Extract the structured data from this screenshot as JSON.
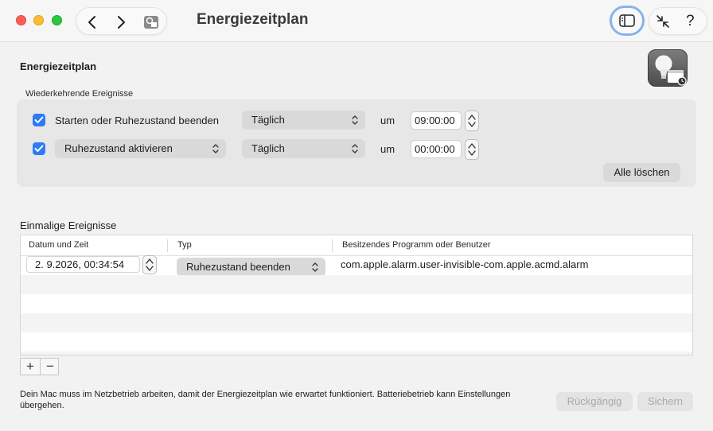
{
  "window": {
    "title": "Energiezeitplan",
    "help_label": "?"
  },
  "main": {
    "section_title": "Energiezeitplan",
    "recurring": {
      "group_label": "Wiederkehrende Ereignisse",
      "rows": [
        {
          "checked": true,
          "action": "Starten oder Ruhezustand beenden",
          "frequency": "Täglich",
          "um": "um",
          "time": "09:00:00"
        },
        {
          "checked": true,
          "action": "Ruhezustand aktivieren",
          "frequency": "Täglich",
          "um": "um",
          "time": "00:00:00"
        }
      ],
      "clear_all_label": "Alle löschen"
    },
    "once": {
      "label": "Einmalige Ereignisse",
      "columns": [
        "Datum und Zeit",
        "Typ",
        "Besitzendes Programm oder Benutzer"
      ],
      "rows": [
        {
          "datetime": "2.  9.2026, 00:34:54",
          "type": "Ruhezustand beenden",
          "owner": "com.apple.alarm.user-invisible-com.apple.acmd.alarm"
        }
      ],
      "add_label": "+",
      "remove_label": "−"
    },
    "footnote": "Dein Mac muss im Netzbetrieb arbeiten, damit der Energiezeitplan wie erwartet funktioniert. Batteriebetrieb kann Einstellungen übergehen.",
    "revert_label": "Rückgängig",
    "save_label": "Sichern"
  },
  "colors": {
    "accent": "#2f7bf5",
    "focus_ring": "#86b2ef"
  }
}
